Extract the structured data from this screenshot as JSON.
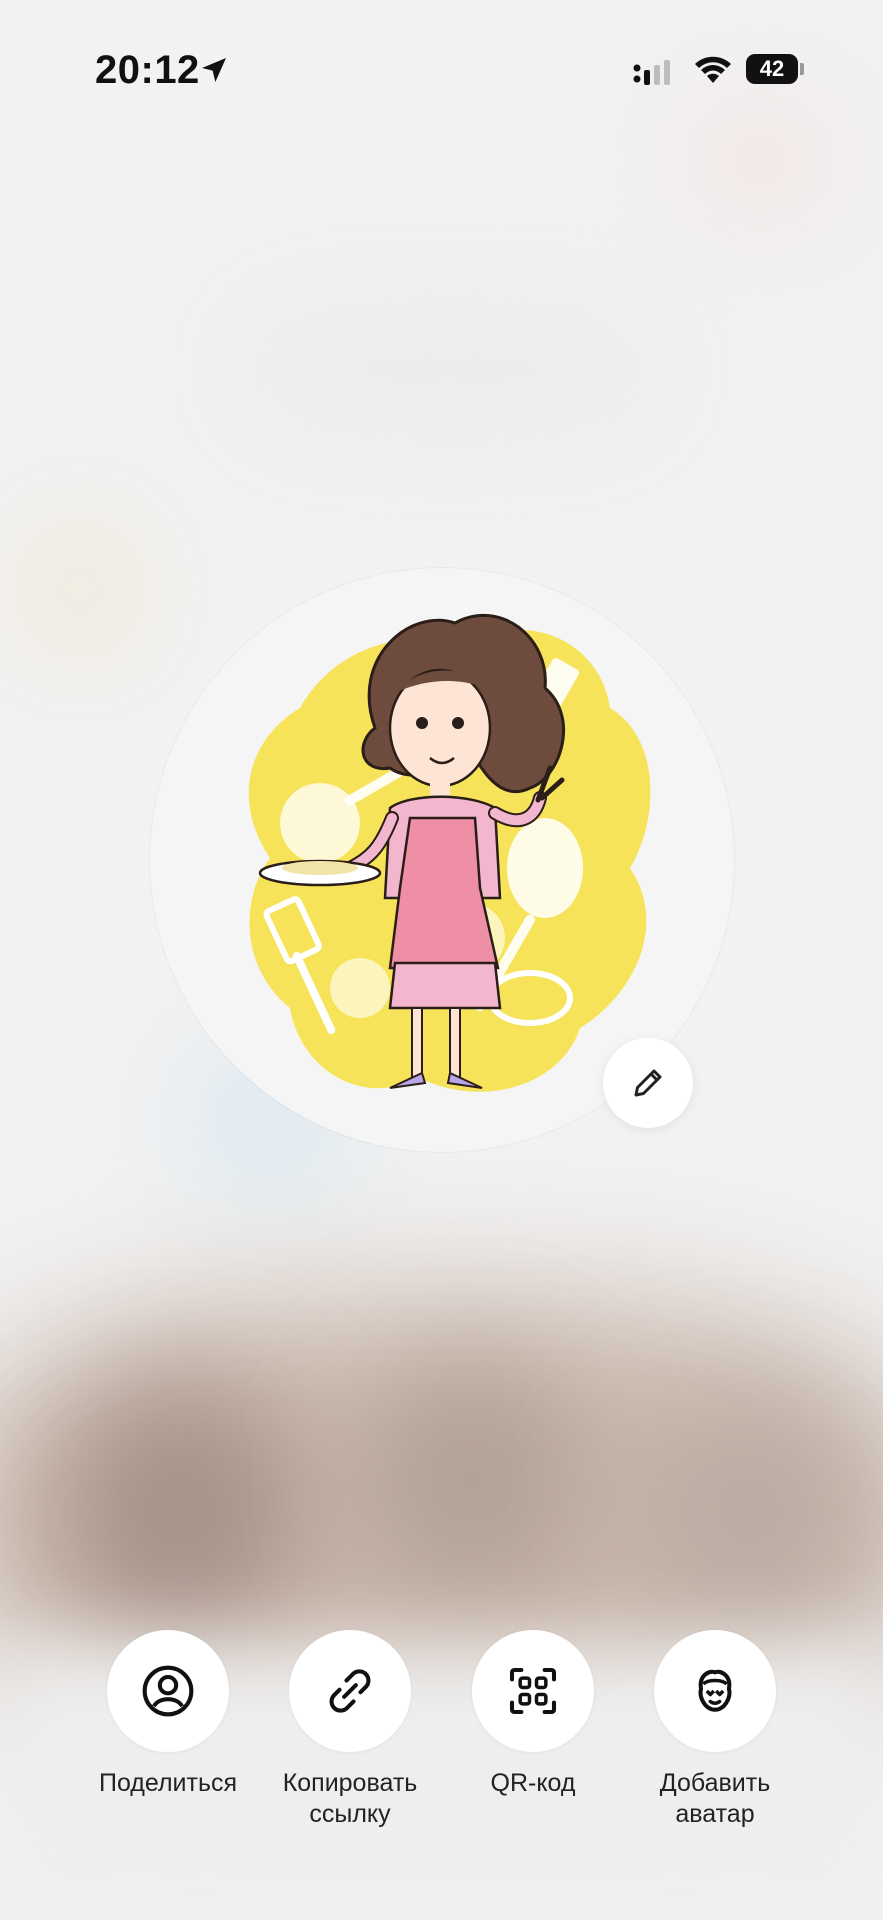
{
  "status_bar": {
    "time": "20:12",
    "battery_level": "42",
    "icons": [
      "location-arrow-icon",
      "cellular-signal-icon",
      "wifi-icon",
      "battery-icon"
    ]
  },
  "avatar": {
    "edit_icon": "pencil-icon"
  },
  "actions": [
    {
      "label": "Поделиться",
      "icon": "person-circle-icon"
    },
    {
      "label": "Копировать\nссылку",
      "icon": "link-icon"
    },
    {
      "label": "QR-код",
      "icon": "qr-scan-icon"
    },
    {
      "label": "Добавить\nаватар",
      "icon": "avatar-face-icon"
    }
  ],
  "colors": {
    "background": "#f2f2f2",
    "button_bg": "#ffffff",
    "text": "#222222",
    "avatar_yellow": "#f6e35a",
    "apron_pink": "#ee8fa6"
  }
}
